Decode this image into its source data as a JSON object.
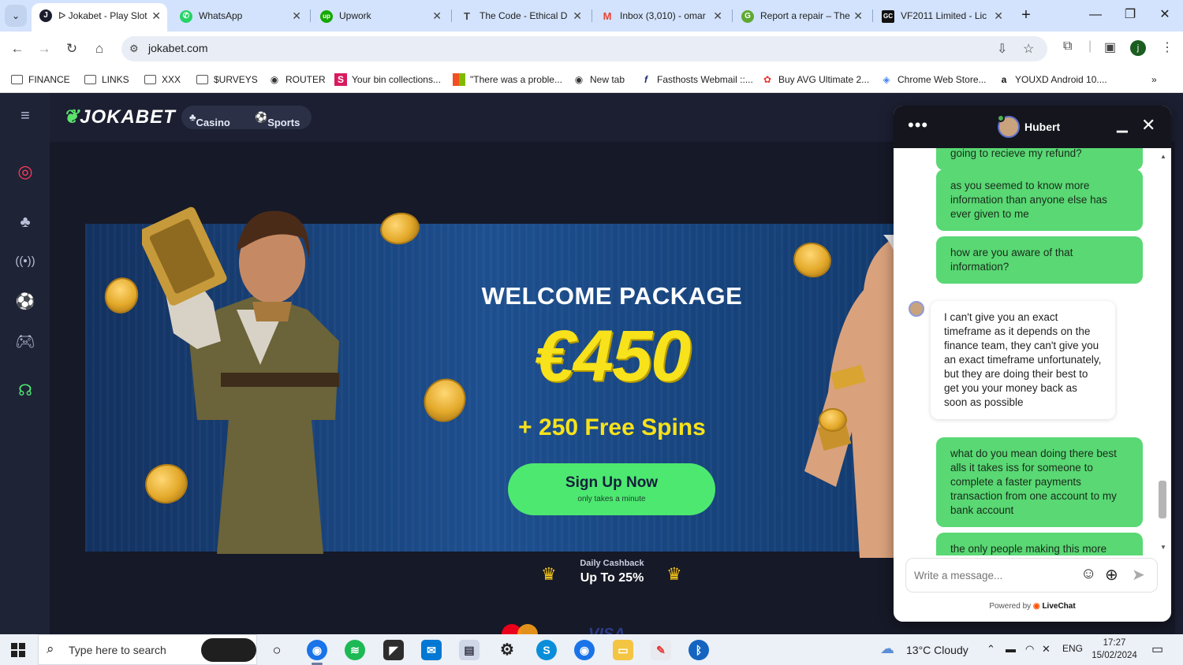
{
  "browser": {
    "tabs": [
      {
        "title": "ᐅ Jokabet - Play Slot",
        "icon": "jokabet-icon",
        "color": "#1a1d2e",
        "active": true
      },
      {
        "title": "WhatsApp",
        "icon": "whatsapp-icon",
        "color": "#25d366",
        "active": false
      },
      {
        "title": "Upwork",
        "icon": "upwork-icon",
        "color": "#14a800",
        "active": false
      },
      {
        "title": "The Code - Ethical D",
        "icon": "document-icon",
        "color": "#444444",
        "active": false
      },
      {
        "title": "Inbox (3,010) - omar",
        "icon": "gmail-icon",
        "color": "#ea4335",
        "active": false
      },
      {
        "title": "Report a repair – The",
        "icon": "site-icon",
        "color": "#5fa832",
        "active": false
      },
      {
        "title": "VF2011 Limited - Lic",
        "icon": "gc-icon",
        "color": "#111111",
        "active": false
      }
    ],
    "url": "jokabet.com",
    "profile_initial": "j",
    "bookmarks": [
      {
        "label": "FINANCE",
        "icon": "folder-icon"
      },
      {
        "label": "LINKS",
        "icon": "folder-icon"
      },
      {
        "label": "XXX",
        "icon": "folder-icon"
      },
      {
        "label": "$URVEYS",
        "icon": "folder-icon"
      },
      {
        "label": "ROUTER",
        "icon": "globe-icon"
      },
      {
        "label": "Your bin collections...",
        "icon": "s-icon"
      },
      {
        "label": "\"There was a proble...",
        "icon": "microsoft-icon"
      },
      {
        "label": "New tab",
        "icon": "globe-icon"
      },
      {
        "label": "Fasthosts Webmail ::...",
        "icon": "f-icon"
      },
      {
        "label": "Buy AVG Ultimate 2...",
        "icon": "avg-icon"
      },
      {
        "label": "Chrome Web Store...",
        "icon": "webstore-icon"
      },
      {
        "label": "YOUXD Android 10....",
        "icon": "amazon-icon"
      }
    ]
  },
  "site": {
    "logo": "JOKABET",
    "nav": {
      "casino": "Casino",
      "sports": "Sports"
    },
    "banner": {
      "heading": "WELCOME PACKAGE",
      "amount": "€450",
      "spins": "+ 250 Free Spins",
      "cta_label": "Sign Up Now",
      "cta_sub": "only takes a minute"
    },
    "cashback": {
      "label": "Daily Cashback",
      "value": "Up To 25%"
    },
    "colors": {
      "accent": "#4de870",
      "highlight": "#f7e21b",
      "background": "#161927"
    }
  },
  "chat": {
    "agent_name": "Hubert",
    "messages": [
      {
        "from": "me",
        "text": "going to recieve my refund?"
      },
      {
        "from": "me",
        "text": "as you seemed to know more information than anyone else has ever given to me"
      },
      {
        "from": "me",
        "text": "how are you aware of that information?"
      },
      {
        "from": "agent",
        "text": "I can't give you an exact timeframe as it depends on the finance team, they can't give you an exact timeframe unfortunately, but they are doing their best to get you your money back as soon as possible"
      },
      {
        "from": "me",
        "text": "what do you mean doing there best alls it takes iss for someone to complete a faster payments transaction from one account to my bank account"
      },
      {
        "from": "me",
        "text": "the only people making this more"
      }
    ],
    "input_placeholder": "Write a message...",
    "powered_prefix": "Powered by",
    "powered_brand": "LiveChat"
  },
  "taskbar": {
    "search_placeholder": "Type here to search",
    "weather": "13°C  Cloudy",
    "language": "ENG",
    "time": "17:27",
    "date": "15/02/2024"
  }
}
